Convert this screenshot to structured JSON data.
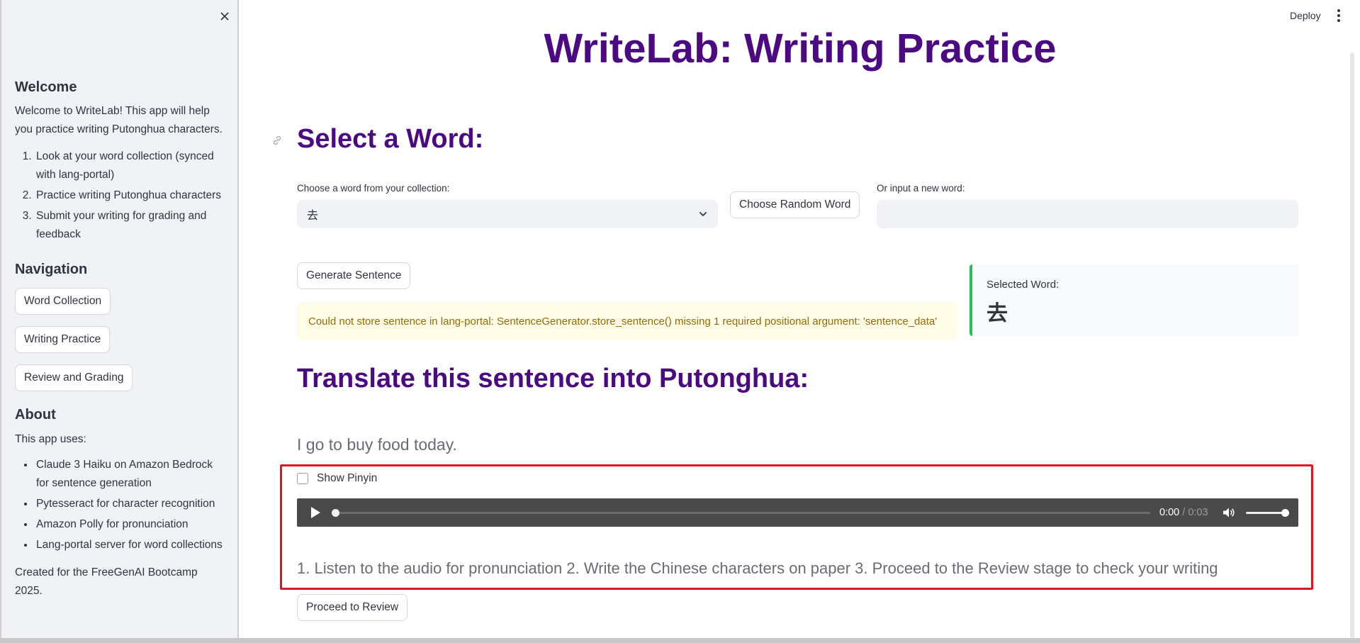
{
  "sidebar": {
    "welcome_heading": "Welcome",
    "welcome_text": "Welcome to WriteLab! This app will help you practice writing Putonghua characters.",
    "steps": [
      "Look at your word collection (synced with lang-portal)",
      "Practice writing Putonghua characters",
      "Submit your writing for grading and feedback"
    ],
    "navigation_heading": "Navigation",
    "nav_buttons": [
      "Word Collection",
      "Writing Practice",
      "Review and Grading"
    ],
    "about_heading": "About",
    "about_intro": "This app uses:",
    "about_items": [
      "Claude 3 Haiku on Amazon Bedrock for sentence generation",
      "Pytesseract for character recognition",
      "Amazon Polly for pronunciation",
      "Lang-portal server for word collections"
    ],
    "footer": "Created for the FreeGenAI Bootcamp 2025."
  },
  "header": {
    "deploy_label": "Deploy"
  },
  "main": {
    "title": "WriteLab: Writing Practice",
    "select_heading": "Select a Word:",
    "collection_label": "Choose a word from your collection:",
    "collection_value": "去",
    "random_button": "Choose Random Word",
    "new_word_label": "Or input a new word:",
    "new_word_value": "",
    "generate_button": "Generate Sentence",
    "warning_text": "Could not store sentence in lang-portal: SentenceGenerator.store_sentence() missing 1 required positional argument: 'sentence_data'",
    "selected_word_label": "Selected Word:",
    "selected_word_value": "去",
    "translate_heading": "Translate this sentence into Putonghua:",
    "sentence": "I go to buy food today.",
    "show_pinyin_label": "Show Pinyin",
    "show_pinyin_checked": false,
    "audio": {
      "current_time": "0:00",
      "separator": "/",
      "duration": "0:03",
      "progress": 0,
      "volume": 1.0
    },
    "instructions": "1. Listen to the audio for pronunciation 2. Write the Chinese characters on paper 3. Proceed to the Review stage to check your writing",
    "proceed_button": "Proceed to Review"
  },
  "colors": {
    "accent": "#4b0a82",
    "highlight_border": "#e3131f",
    "success_bar": "#21c354",
    "warning_bg": "#fffce7",
    "warning_text": "#926c05"
  }
}
